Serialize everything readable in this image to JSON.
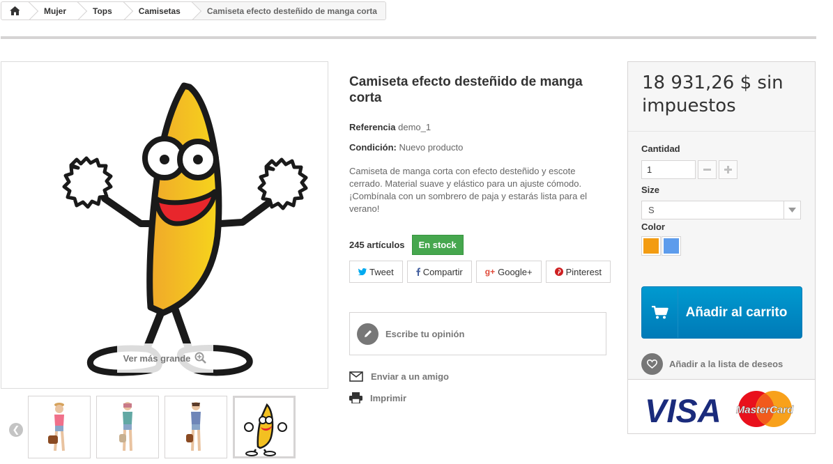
{
  "breadcrumb": {
    "items": [
      "Mujer",
      "Tops",
      "Camisetas"
    ],
    "current": "Camiseta efecto desteñido de manga corta"
  },
  "image": {
    "zoom_label": "Ver más grande"
  },
  "product": {
    "title": "Camiseta efecto desteñido de manga corta",
    "reference_label": "Referencia",
    "reference_value": "demo_1",
    "condition_label": "Condición:",
    "condition_value": "Nuevo producto",
    "description": "Camiseta de manga corta con efecto desteñido y escote cerrado. Material suave y elástico para un ajuste cómodo. ¡Combínala con un sombrero de paja y estarás lista para el verano!",
    "stock_count": "245 artículos",
    "stock_status": "En stock"
  },
  "share": {
    "tweet": "Tweet",
    "facebook": "Compartir",
    "google": "Google+",
    "pinterest": "Pinterest"
  },
  "review": {
    "write_label": "Escribe tu opinión"
  },
  "links": {
    "send_friend": "Enviar a un amigo",
    "print": "Imprimir"
  },
  "buy": {
    "price": "18 931,26 $ sin impuestos",
    "quantity_label": "Cantidad",
    "quantity_value": "1",
    "size_label": "Size",
    "size_value": "S",
    "color_label": "Color",
    "colors": [
      "#f39c11",
      "#5d9cec"
    ],
    "add_to_cart": "Añadir al carrito",
    "wishlist": "Añadir a la lista de deseos",
    "card_visa": "VISA",
    "card_mastercard": "MasterCard"
  },
  "colors": {
    "accent": "#0098d1",
    "stock_green": "#46a74e",
    "text": "#333333",
    "muted": "#777777"
  }
}
